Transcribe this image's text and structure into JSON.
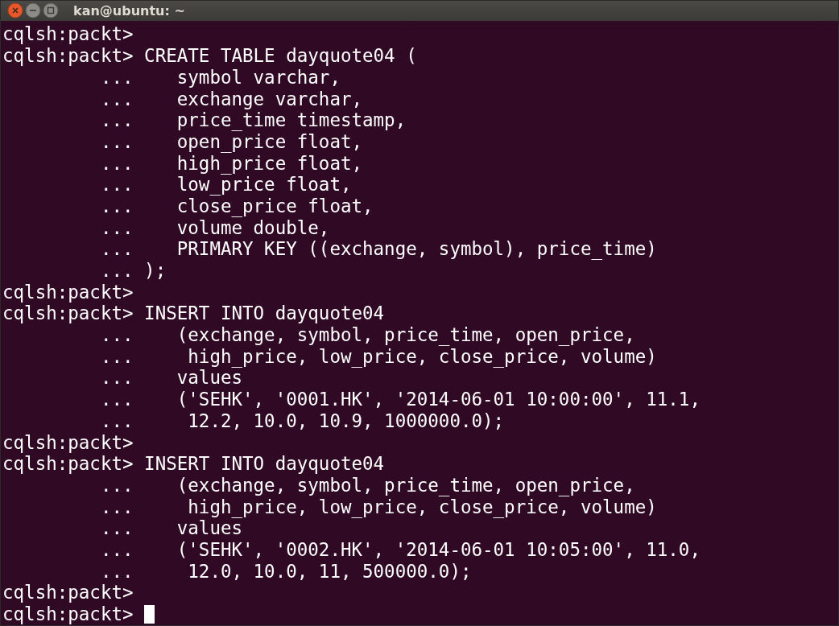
{
  "window": {
    "title": "kan@ubuntu: ~"
  },
  "terminal": {
    "lines": [
      "cqlsh:packt>",
      "cqlsh:packt> CREATE TABLE dayquote04 (",
      "         ...    symbol varchar,",
      "         ...    exchange varchar,",
      "         ...    price_time timestamp,",
      "         ...    open_price float,",
      "         ...    high_price float,",
      "         ...    low_price float,",
      "         ...    close_price float,",
      "         ...    volume double,",
      "         ...    PRIMARY KEY ((exchange, symbol), price_time)",
      "         ... );",
      "cqlsh:packt>",
      "cqlsh:packt> INSERT INTO dayquote04",
      "         ...    (exchange, symbol, price_time, open_price,",
      "         ...     high_price, low_price, close_price, volume)",
      "         ...    values",
      "         ...    ('SEHK', '0001.HK', '2014-06-01 10:00:00', 11.1,",
      "         ...     12.2, 10.0, 10.9, 1000000.0);",
      "cqlsh:packt>",
      "cqlsh:packt> INSERT INTO dayquote04",
      "         ...    (exchange, symbol, price_time, open_price,",
      "         ...     high_price, low_price, close_price, volume)",
      "         ...    values",
      "         ...    ('SEHK', '0002.HK', '2014-06-01 10:05:00', 11.0,",
      "         ...     12.0, 10.0, 11, 500000.0);",
      "cqlsh:packt>",
      "cqlsh:packt> "
    ],
    "cursor": true
  }
}
